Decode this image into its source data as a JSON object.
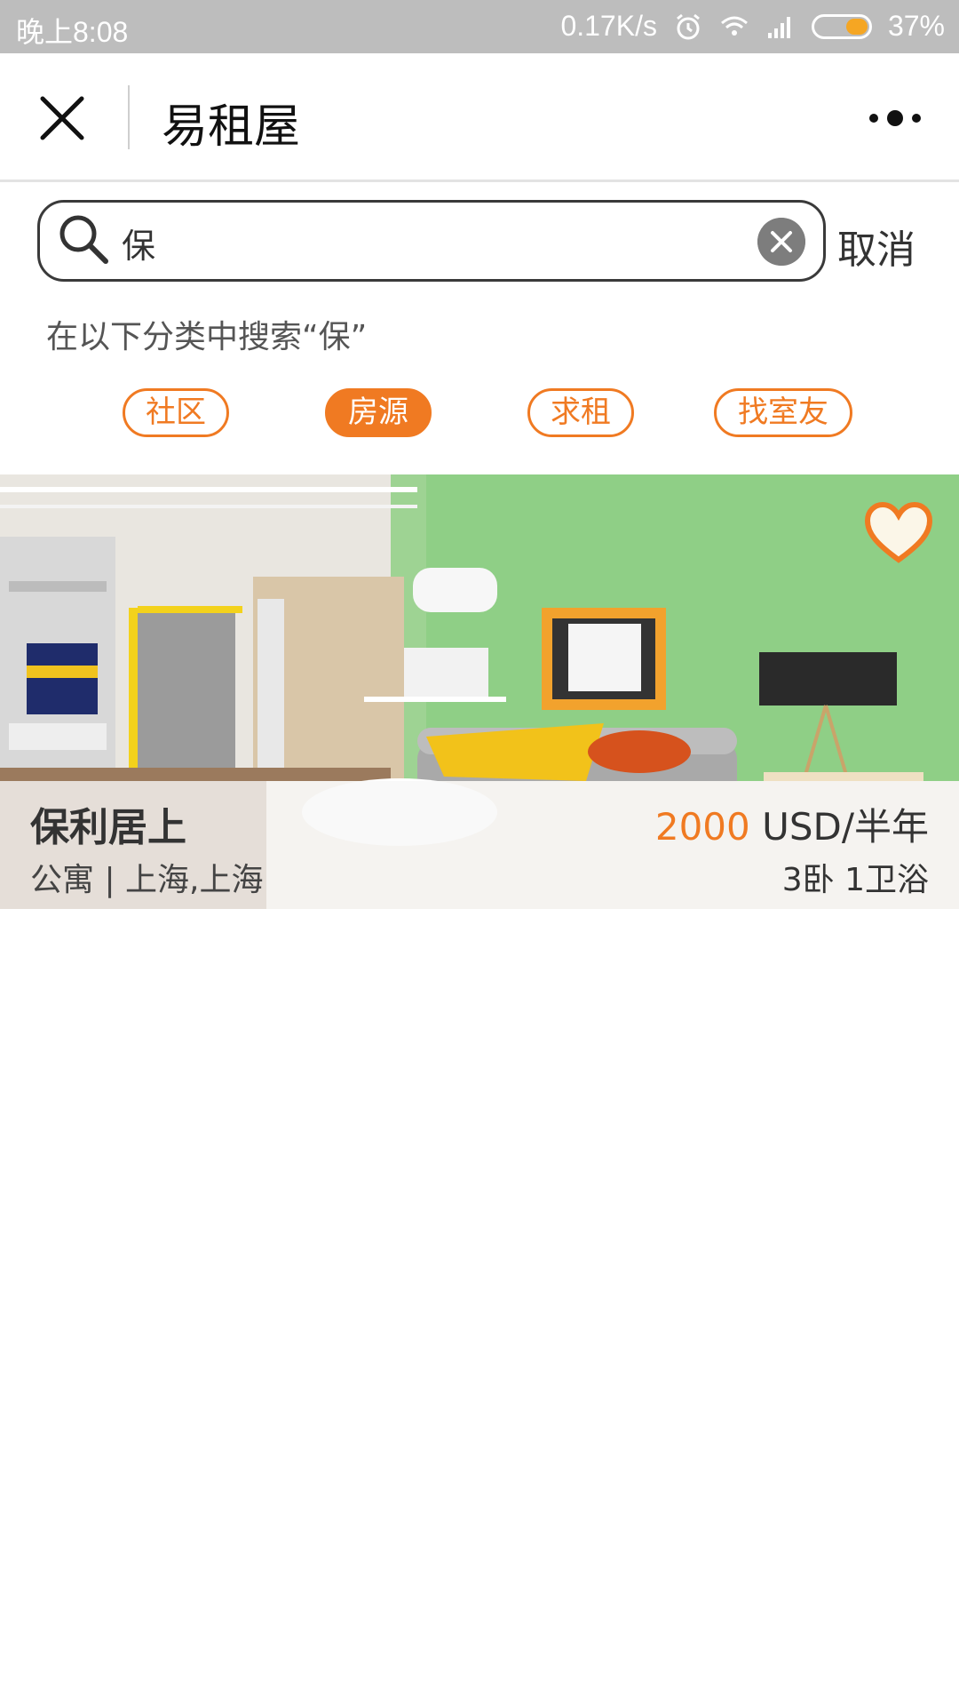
{
  "status_bar": {
    "time": "晚上8:08",
    "network_speed": "0.17K/s",
    "battery_percent": "37%",
    "battery_level": 0.37
  },
  "title_bar": {
    "title": "易租屋",
    "close_icon": "close-icon",
    "more_icon": "more-dots-icon"
  },
  "search": {
    "query": "保",
    "cancel_label": "取消"
  },
  "hint": "在以下分类中搜索“保”",
  "tabs": [
    {
      "label": "社区",
      "active": false
    },
    {
      "label": "房源",
      "active": true
    },
    {
      "label": "求租",
      "active": false
    },
    {
      "label": "找室友",
      "active": false
    }
  ],
  "listing": {
    "title": "保利居上",
    "subtitle": "公寓 | 上海,上海",
    "price": "2000",
    "price_unit": " USD/半年",
    "rooms": "3卧 1卫浴",
    "favorite_icon": "heart-icon"
  },
  "colors": {
    "accent": "#f07a22",
    "status_bar": "#bdbdbd"
  }
}
